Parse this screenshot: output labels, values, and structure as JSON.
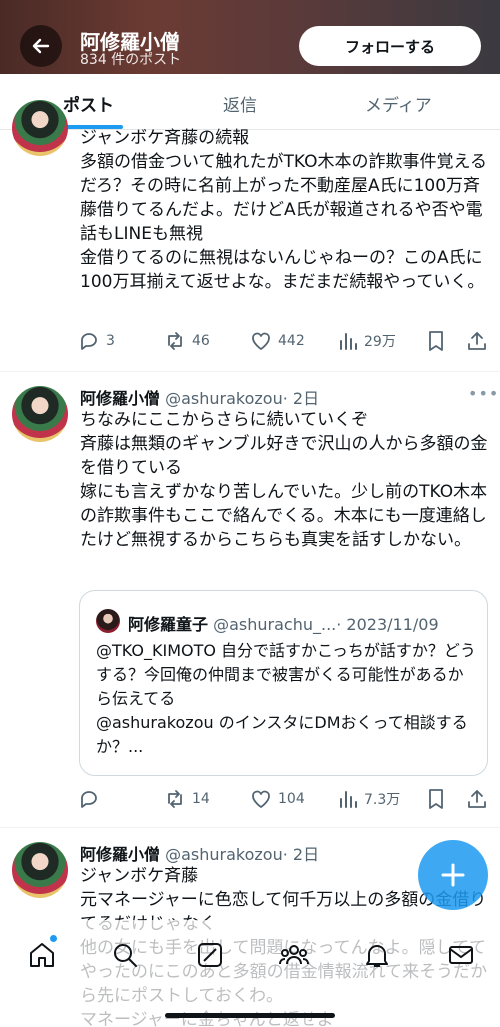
{
  "header": {
    "title": "阿修羅小僧",
    "subtitle": "834 件のポスト",
    "follow_label": "フォローする"
  },
  "tabs": [
    {
      "label": "ポスト",
      "active": true
    },
    {
      "label": "返信",
      "active": false
    },
    {
      "label": "メディア",
      "active": false
    }
  ],
  "posts": [
    {
      "text": "ジャンボケ斉藤の続報\n多額の借金ついて触れたがTKO木本の詐欺事件覚えるだろ？その時に名前上がった不動産屋A氏に100万斉藤借りてるんだよ。だけどA氏が報道されるや否や電話もLINEも無視\n金借りてるのに無視はないんじゃねーの？このA氏に100万耳揃えて返せよな。まだまだ続報やっていく。",
      "replies": "3",
      "reposts": "46",
      "likes": "442",
      "views": "29万"
    },
    {
      "name": "阿修羅小僧",
      "handle": "@ashurakozou",
      "time": "· 2日",
      "text": "ちなみにここからさらに続いていくぞ\n斉藤は無類のギャンブル好きで沢山の人から多額の金を借りている\n嫁にも言えずかなり苦しんでいた。少し前のTKO木本の詐欺事件もここで絡んでくる。木本にも一度連絡したけど無視するからこちらも真実を話すしかない。",
      "quote": {
        "name": "阿修羅童子",
        "handle": "@ashurachu_...",
        "date": "· 2023/11/09",
        "text": "@TKO_KIMOTO 自分で話すかこっちが話すか？どうする？今回俺の仲間まで被害がくる可能性があるから伝えてる\n@ashurakozou のインスタにDMおくって相談するか？..."
      },
      "replies": "",
      "reposts": "14",
      "likes": "104",
      "views": "7.3万"
    },
    {
      "name": "阿修羅小僧",
      "handle": "@ashurakozou",
      "time": "· 2日",
      "text": "ジャンボケ斉藤\n元マネージャーに色恋して何千万以上の多額の金借りてるだけじゃなく\n他の女にも手を出して問題になってんなよ。隠しててやったのにこのあと多額の借金情報流れて来そうだから先にポストしておくわ。\nマネージャーに金ちゃんと返せよ"
    }
  ],
  "icons": {
    "back": "arrow-left-icon",
    "more": "more-dots-icon",
    "reply": "reply-icon",
    "repost": "repost-icon",
    "like": "heart-icon",
    "views": "views-icon",
    "bookmark": "bookmark-icon",
    "share": "share-icon",
    "compose": "plus-icon",
    "nav": [
      "home-icon",
      "search-icon",
      "grok-icon",
      "communities-icon",
      "notifications-icon",
      "messages-icon"
    ]
  },
  "colors": {
    "accent": "#1d9bf0",
    "text": "#0f1419",
    "secondary": "#536471"
  }
}
